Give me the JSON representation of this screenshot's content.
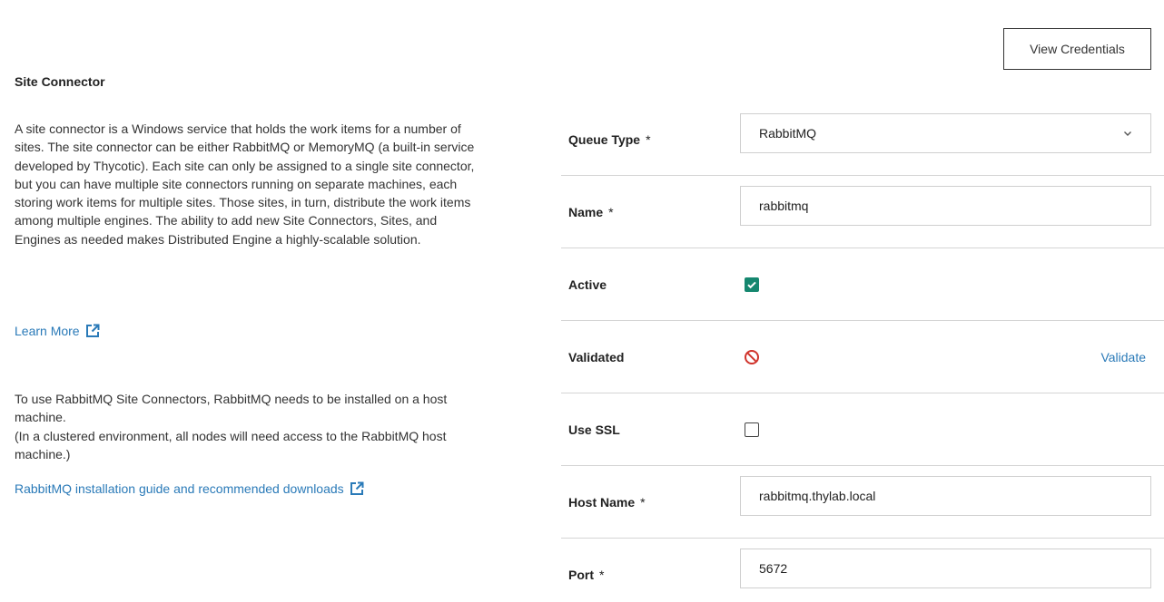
{
  "info": {
    "title": "Site Connector",
    "description": "A site connector is a Windows service that holds the work items for a number of sites. The site connector can be either RabbitMQ or MemoryMQ (a built-in service developed by Thycotic). Each site can only be assigned to a single site connector, but you can have multiple site connectors running on separate machines, each storing work items for multiple sites. Those sites, in turn, distribute the work items among multiple engines. The ability to add new Site Connectors, Sites, and Engines as needed makes Distributed Engine a highly-scalable solution.",
    "learn_more": "Learn More",
    "rabbit_note_line1": "To use RabbitMQ Site Connectors, RabbitMQ needs to be installed on a host machine.",
    "rabbit_note_line2": "(In a clustered environment, all nodes will need access to the RabbitMQ host machine.)",
    "rabbit_link": "RabbitMQ installation guide and recommended downloads"
  },
  "toolbar": {
    "view_credentials": "View Credentials"
  },
  "form": {
    "required_marker": "*",
    "queue_type": {
      "label": "Queue Type",
      "value": "RabbitMQ"
    },
    "name": {
      "label": "Name",
      "value": "rabbitmq"
    },
    "active": {
      "label": "Active",
      "checked": true
    },
    "validated": {
      "label": "Validated",
      "status_icon": "no-entry-icon",
      "action": "Validate"
    },
    "use_ssl": {
      "label": "Use SSL",
      "checked": false
    },
    "host_name": {
      "label": "Host Name",
      "value": "rabbitmq.thylab.local"
    },
    "port": {
      "label": "Port",
      "value": "5672"
    }
  },
  "colors": {
    "link": "#2a7ab8",
    "checkbox_checked": "#15876f",
    "invalid_icon": "#d0342c",
    "divider": "#d5d5d5"
  }
}
